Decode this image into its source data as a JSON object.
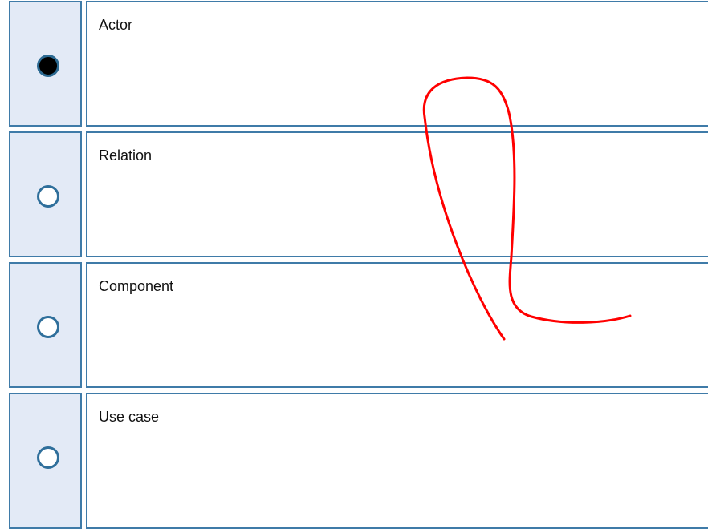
{
  "options": [
    {
      "label": "Actor",
      "selected": true
    },
    {
      "label": "Relation",
      "selected": false
    },
    {
      "label": "Component",
      "selected": false
    },
    {
      "label": "Use case",
      "selected": false
    }
  ],
  "colors": {
    "radio_cell_bg": "#e3eaf6",
    "border": "#3f7ba8",
    "annotation_stroke": "#ff0000"
  }
}
